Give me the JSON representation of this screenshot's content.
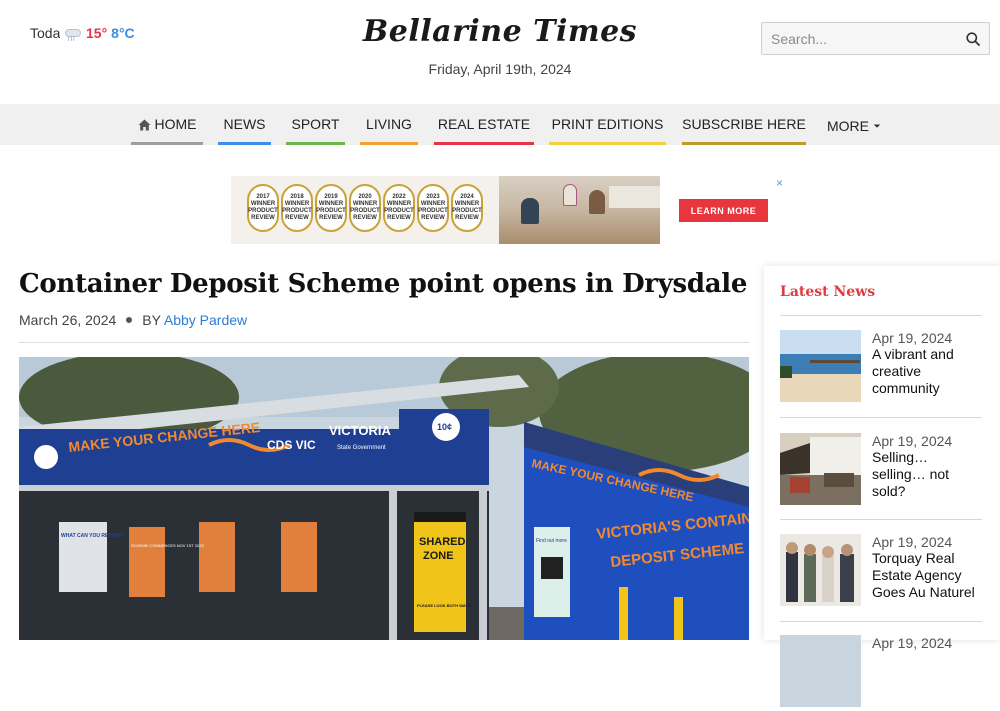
{
  "weather": {
    "today_label": "Today",
    "high": "15°",
    "low": "8°C",
    "icon": "rain-cloud-icon"
  },
  "masthead": {
    "title": "Bellarine Times",
    "date": "Friday, April 19th, 2024"
  },
  "search": {
    "placeholder": "Search...",
    "icon": "search-icon"
  },
  "nav": {
    "items": [
      {
        "label": "HOME",
        "color": "#9e9e9e",
        "icon": "home-icon"
      },
      {
        "label": "NEWS",
        "color": "#3b8fe6"
      },
      {
        "label": "SPORT",
        "color": "#6fb64a"
      },
      {
        "label": "LIVING",
        "color": "#f0a22e"
      },
      {
        "label": "REAL ESTATE",
        "color": "#e8334a"
      },
      {
        "label": "PRINT EDITIONS",
        "color": "#f1d23e"
      },
      {
        "label": "SUBSCRIBE HERE",
        "color": "#b99b2e"
      },
      {
        "label": "MORE",
        "color": "#f0f0f0",
        "icon": "caret-down-icon"
      }
    ]
  },
  "ad": {
    "badges": [
      {
        "year": "2017",
        "line1": "WINNER",
        "line2": "PRODUCT",
        "line3": "REVIEW"
      },
      {
        "year": "2018",
        "line1": "WINNER",
        "line2": "PRODUCT",
        "line3": "REVIEW"
      },
      {
        "year": "2019",
        "line1": "WINNER",
        "line2": "PRODUCT",
        "line3": "REVIEW"
      },
      {
        "year": "2020",
        "line1": "WINNER",
        "line2": "PRODUCT",
        "line3": "REVIEW"
      },
      {
        "year": "2022",
        "line1": "WINNER",
        "line2": "PRODUCT",
        "line3": "REVIEW"
      },
      {
        "year": "2023",
        "line1": "WINNER",
        "line2": "PRODUCT",
        "line3": "REVIEW"
      },
      {
        "year": "2024",
        "line1": "WINNER",
        "line2": "PRODUCT",
        "line3": "REVIEW"
      }
    ],
    "cta": "LEARN MORE",
    "close": "×"
  },
  "article": {
    "title": "Container Deposit Scheme point opens in Drysdale",
    "date": "March 26, 2024",
    "by_label": "BY",
    "author": "Abby Pardew"
  },
  "hero": {
    "banner_left": "MAKE YOUR CHANGE HERE",
    "cds": "CDS VIC",
    "vic": "VICTORIA",
    "vic_sub": "State Government",
    "refund": "10¢",
    "side_banner": "MAKE YOUR CHANGE HERE",
    "side_title_1": "VICTORIA'S CONTAINER",
    "side_title_2": "DEPOSIT SCHEME",
    "shared_zone_1": "SHARED",
    "shared_zone_2": "ZONE",
    "shared_zone_3": "PLEASE LOOK BOTH WAYS",
    "find_out": "Find out more",
    "screen_text": "SCHEME COMMENCES NOV 1ST 2023",
    "what_can": "WHAT CAN YOU RETURN?"
  },
  "sidebar": {
    "heading": "Latest News",
    "items": [
      {
        "date": "Apr 19, 2024",
        "title": "A vibrant and creative community"
      },
      {
        "date": "Apr 19, 2024",
        "title": "Selling… selling… not sold?"
      },
      {
        "date": "Apr 19, 2024",
        "title": "Torquay Real Estate Agency Goes Au Naturel"
      },
      {
        "date": "Apr 19, 2024",
        "title": ""
      }
    ]
  }
}
